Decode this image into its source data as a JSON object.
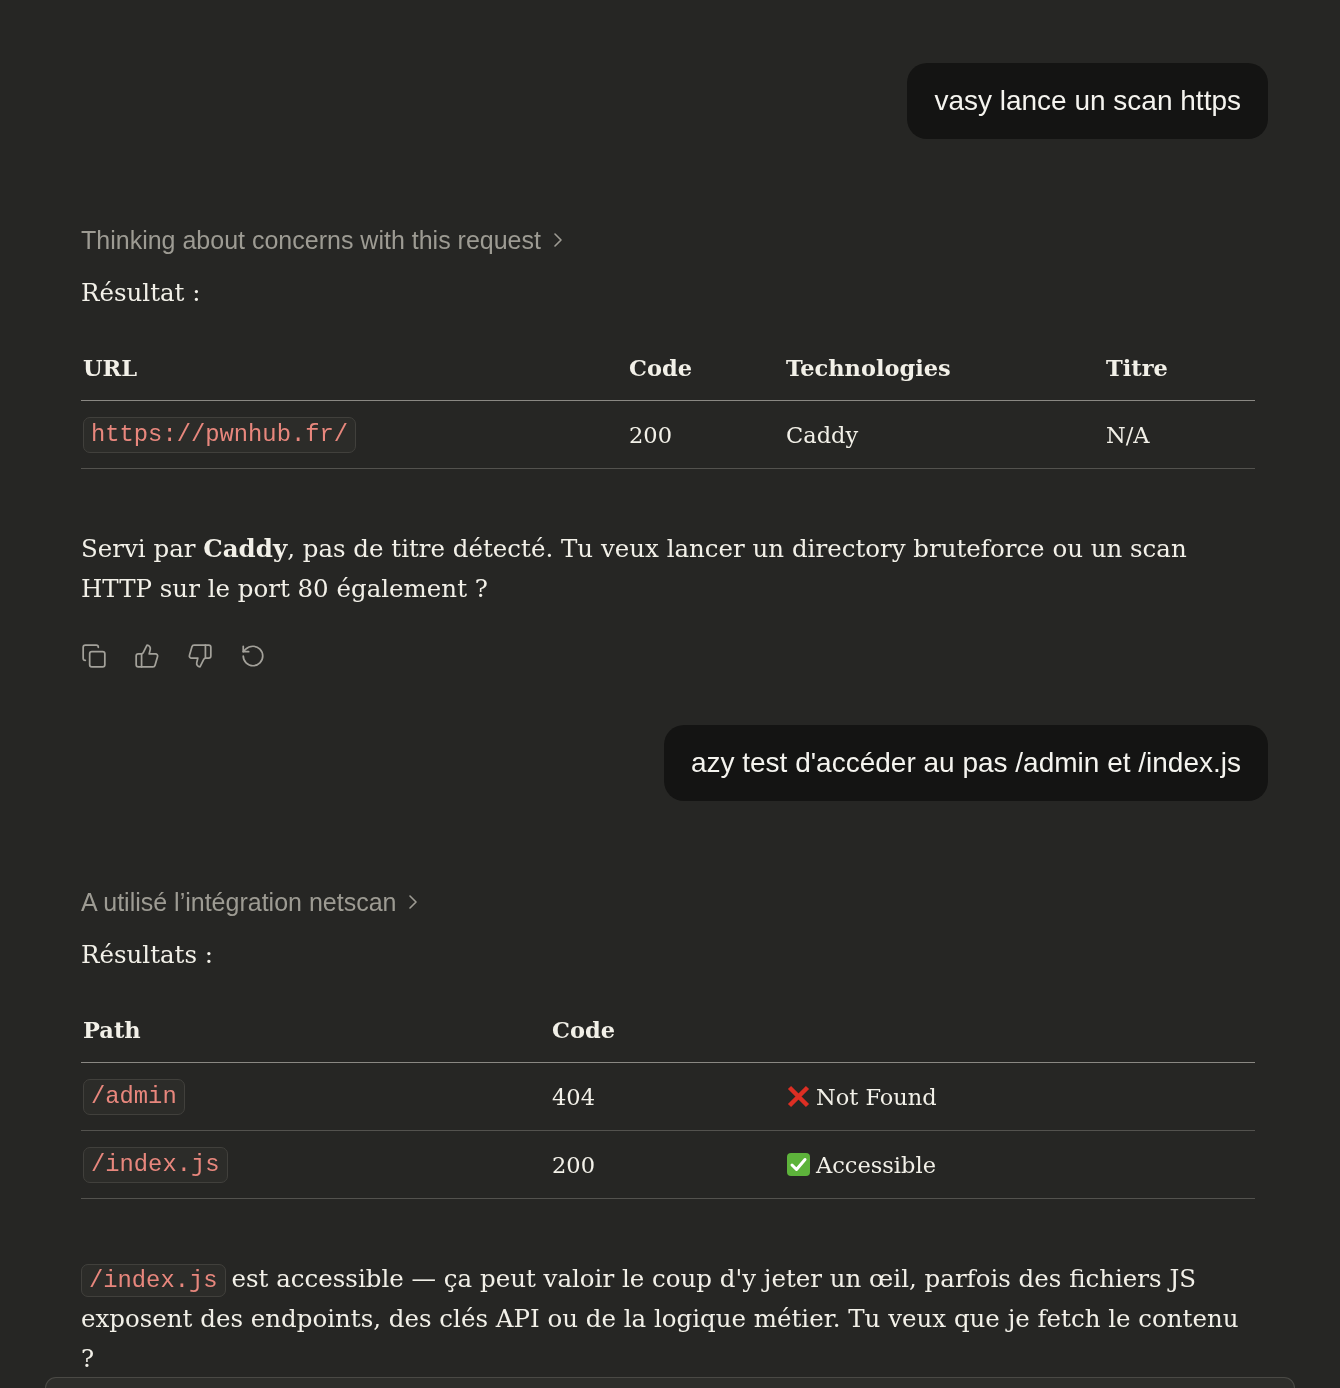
{
  "messages": [
    {
      "kind": "user",
      "text": "vasy lance un scan https"
    },
    {
      "kind": "assistant",
      "status_line": "Thinking about concerns with this request",
      "toolbar": true,
      "blocks": [
        {
          "kind": "heading",
          "text": "Résultat :"
        },
        {
          "kind": "table",
          "columns": [
            "URL",
            "Code",
            "Technologies",
            "Titre"
          ],
          "rows": [
            {
              "cells": [
                {
                  "kind": "code",
                  "text": "https://pwnhub.fr/"
                },
                {
                  "kind": "text",
                  "text": "200"
                },
                {
                  "kind": "text",
                  "text": "Caddy"
                },
                {
                  "kind": "text",
                  "text": "N/A"
                }
              ]
            }
          ]
        },
        {
          "kind": "paragraph",
          "parts": [
            {
              "kind": "text",
              "text": "Servi par **Caddy**, pas de titre détecté. Tu veux lancer un directory bruteforce ou un scan HTTP sur le port 80 également ?"
            }
          ]
        }
      ]
    },
    {
      "kind": "user",
      "text": "azy test d'accéder au pas /admin et /index.js"
    },
    {
      "kind": "assistant",
      "status_line": "A utilisé l’intégration netscan",
      "blocks": [
        {
          "kind": "heading",
          "text": "Résultats :"
        },
        {
          "kind": "table",
          "columns": [
            "Path",
            "Code"
          ],
          "rows": [
            {
              "cells": [
                {
                  "kind": "code",
                  "text": "/admin"
                },
                {
                  "kind": "text",
                  "text": "404"
                },
                {
                  "kind": "status",
                  "ok": false,
                  "text": "Not Found"
                }
              ]
            },
            {
              "cells": [
                {
                  "kind": "code",
                  "text": "/index.js"
                },
                {
                  "kind": "text",
                  "text": "200"
                },
                {
                  "kind": "status",
                  "ok": true,
                  "text": "Accessible"
                }
              ]
            }
          ]
        },
        {
          "kind": "paragraph",
          "parts": [
            {
              "kind": "code",
              "text": "/index.js"
            },
            {
              "kind": "text",
              "text": "est accessible — ça peut valoir le coup d'y jeter un œil, parfois des fichiers JS exposent des endpoints, des clés API ou de la logique métier. Tu veux que je fetch le contenu ?"
            }
          ]
        }
      ]
    }
  ]
}
